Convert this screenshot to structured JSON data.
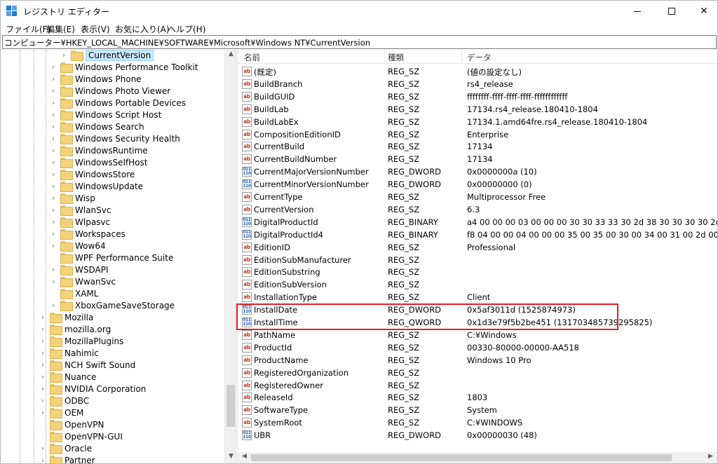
{
  "window": {
    "title": "レジストリ エディター",
    "minimize_glyph": "—",
    "maximize_glyph": "☐",
    "close_glyph": "✕"
  },
  "menu": [
    "ファイル(F)",
    "編集(E)",
    "表示(V)",
    "お気に入り(A)",
    "ヘルプ(H)"
  ],
  "address": "コンピューター¥HKEY_LOCAL_MACHINE¥SOFTWARE¥Microsoft¥Windows NT¥CurrentVersion",
  "tree": {
    "items": [
      {
        "label": "CurrentVersion",
        "level": 2,
        "selected": true,
        "expandable": true
      },
      {
        "label": "Windows Performance Toolkit",
        "level": 1,
        "expandable": true
      },
      {
        "label": "Windows Phone",
        "level": 1,
        "expandable": true
      },
      {
        "label": "Windows Photo Viewer",
        "level": 1,
        "expandable": true
      },
      {
        "label": "Windows Portable Devices",
        "level": 1,
        "expandable": true
      },
      {
        "label": "Windows Script Host",
        "level": 1,
        "expandable": true
      },
      {
        "label": "Windows Search",
        "level": 1,
        "expandable": true
      },
      {
        "label": "Windows Security Health",
        "level": 1,
        "expandable": true
      },
      {
        "label": "WindowsRuntime",
        "level": 1,
        "expandable": true
      },
      {
        "label": "WindowsSelfHost",
        "level": 1,
        "expandable": true
      },
      {
        "label": "WindowsStore",
        "level": 1,
        "expandable": true
      },
      {
        "label": "WindowsUpdate",
        "level": 1,
        "expandable": true
      },
      {
        "label": "Wisp",
        "level": 1,
        "expandable": true
      },
      {
        "label": "WlanSvc",
        "level": 1,
        "expandable": true
      },
      {
        "label": "Wlpasvc",
        "level": 1,
        "expandable": true
      },
      {
        "label": "Workspaces",
        "level": 1,
        "expandable": true
      },
      {
        "label": "Wow64",
        "level": 1,
        "expandable": true
      },
      {
        "label": "WPF Performance Suite",
        "level": 1,
        "expandable": false
      },
      {
        "label": "WSDAPI",
        "level": 1,
        "expandable": true
      },
      {
        "label": "WwanSvc",
        "level": 1,
        "expandable": true
      },
      {
        "label": "XAML",
        "level": 1,
        "expandable": false
      },
      {
        "label": "XboxGameSaveStorage",
        "level": 1,
        "expandable": true
      },
      {
        "label": "Mozilla",
        "level": 0,
        "expandable": true
      },
      {
        "label": "mozilla.org",
        "level": 0,
        "expandable": true
      },
      {
        "label": "MozillaPlugins",
        "level": 0,
        "expandable": true
      },
      {
        "label": "Nahimic",
        "level": 0,
        "expandable": true
      },
      {
        "label": "NCH Swift Sound",
        "level": 0,
        "expandable": true
      },
      {
        "label": "Nuance",
        "level": 0,
        "expandable": true
      },
      {
        "label": "NVIDIA Corporation",
        "level": 0,
        "expandable": true
      },
      {
        "label": "ODBC",
        "level": 0,
        "expandable": true
      },
      {
        "label": "OEM",
        "level": 0,
        "expandable": true
      },
      {
        "label": "OpenVPN",
        "level": 0,
        "expandable": false
      },
      {
        "label": "OpenVPN-GUI",
        "level": 0,
        "expandable": false
      },
      {
        "label": "Oracle",
        "level": 0,
        "expandable": true
      },
      {
        "label": "Partner",
        "level": 0,
        "expandable": true
      }
    ]
  },
  "list": {
    "headers": {
      "name": "名前",
      "type": "種類",
      "data": "データ"
    },
    "rows": [
      {
        "name": "(既定)",
        "type": "REG_SZ",
        "data": "(値の設定なし)",
        "icon": "sz"
      },
      {
        "name": "BuildBranch",
        "type": "REG_SZ",
        "data": "rs4_release",
        "icon": "sz"
      },
      {
        "name": "BuildGUID",
        "type": "REG_SZ",
        "data": "ffffffff-ffff-ffff-ffff-ffffffffffff",
        "icon": "sz"
      },
      {
        "name": "BuildLab",
        "type": "REG_SZ",
        "data": "17134.rs4_release.180410-1804",
        "icon": "sz"
      },
      {
        "name": "BuildLabEx",
        "type": "REG_SZ",
        "data": "17134.1.amd64fre.rs4_release.180410-1804",
        "icon": "sz"
      },
      {
        "name": "CompositionEditionID",
        "type": "REG_SZ",
        "data": "Enterprise",
        "icon": "sz"
      },
      {
        "name": "CurrentBuild",
        "type": "REG_SZ",
        "data": "17134",
        "icon": "sz"
      },
      {
        "name": "CurrentBuildNumber",
        "type": "REG_SZ",
        "data": "17134",
        "icon": "sz"
      },
      {
        "name": "CurrentMajorVersionNumber",
        "type": "REG_DWORD",
        "data": "0x0000000a (10)",
        "icon": "bin"
      },
      {
        "name": "CurrentMinorVersionNumber",
        "type": "REG_DWORD",
        "data": "0x00000000 (0)",
        "icon": "bin"
      },
      {
        "name": "CurrentType",
        "type": "REG_SZ",
        "data": "Multiprocessor Free",
        "icon": "sz"
      },
      {
        "name": "CurrentVersion",
        "type": "REG_SZ",
        "data": "6.3",
        "icon": "sz"
      },
      {
        "name": "DigitalProductId",
        "type": "REG_BINARY",
        "data": "a4 00 00 00 03 00 00 00 30 30 33 33 30 2d 38 30 30 30 30 2d 30 30 30 30 30",
        "icon": "bin"
      },
      {
        "name": "DigitalProductId4",
        "type": "REG_BINARY",
        "data": "f8 04 00 00 04 00 00 00 35 00 35 00 30 00 34 00 31 00 2d 00 30 00 33 00 33 0",
        "icon": "bin"
      },
      {
        "name": "EditionID",
        "type": "REG_SZ",
        "data": "Professional",
        "icon": "sz"
      },
      {
        "name": "EditionSubManufacturer",
        "type": "REG_SZ",
        "data": "",
        "icon": "sz"
      },
      {
        "name": "EditionSubstring",
        "type": "REG_SZ",
        "data": "",
        "icon": "sz"
      },
      {
        "name": "EditionSubVersion",
        "type": "REG_SZ",
        "data": "",
        "icon": "sz"
      },
      {
        "name": "InstallationType",
        "type": "REG_SZ",
        "data": "Client",
        "icon": "sz"
      },
      {
        "name": "InstallDate",
        "type": "REG_DWORD",
        "data": "0x5af3011d (1525874973)",
        "icon": "bin"
      },
      {
        "name": "InstallTime",
        "type": "REG_QWORD",
        "data": "0x1d3e79f5b2be451 (131703485739295825)",
        "icon": "bin"
      },
      {
        "name": "PathName",
        "type": "REG_SZ",
        "data": "C:¥Windows",
        "icon": "sz"
      },
      {
        "name": "ProductId",
        "type": "REG_SZ",
        "data": "00330-80000-00000-AA518",
        "icon": "sz"
      },
      {
        "name": "ProductName",
        "type": "REG_SZ",
        "data": "Windows 10 Pro",
        "icon": "sz"
      },
      {
        "name": "RegisteredOrganization",
        "type": "REG_SZ",
        "data": "",
        "icon": "sz"
      },
      {
        "name": "RegisteredOwner",
        "type": "REG_SZ",
        "data": "",
        "icon": "sz"
      },
      {
        "name": "ReleaseId",
        "type": "REG_SZ",
        "data": "1803",
        "icon": "sz"
      },
      {
        "name": "SoftwareType",
        "type": "REG_SZ",
        "data": "System",
        "icon": "sz"
      },
      {
        "name": "SystemRoot",
        "type": "REG_SZ",
        "data": "C:¥WINDOWS",
        "icon": "sz"
      },
      {
        "name": "UBR",
        "type": "REG_DWORD",
        "data": "0x00000030 (48)",
        "icon": "bin"
      }
    ]
  },
  "icon_glyphs": {
    "sz": "ab",
    "bin": "011 110"
  },
  "colors": {
    "highlight_box": "#e02020",
    "selection": "#cce8ff",
    "folder": "#f5d27a"
  }
}
